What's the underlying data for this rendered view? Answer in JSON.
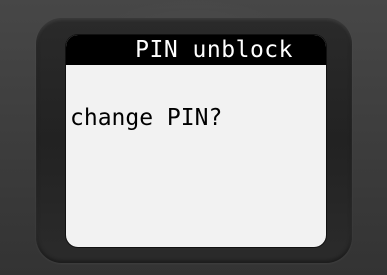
{
  "screen": {
    "title": "PIN unblock",
    "message": "change PIN?"
  },
  "colors": {
    "title_background": "#000000",
    "title_text": "#ffffff",
    "screen_background": "#f2f2f2",
    "bezel": "#262626",
    "device_body": "#3f3f3f"
  }
}
